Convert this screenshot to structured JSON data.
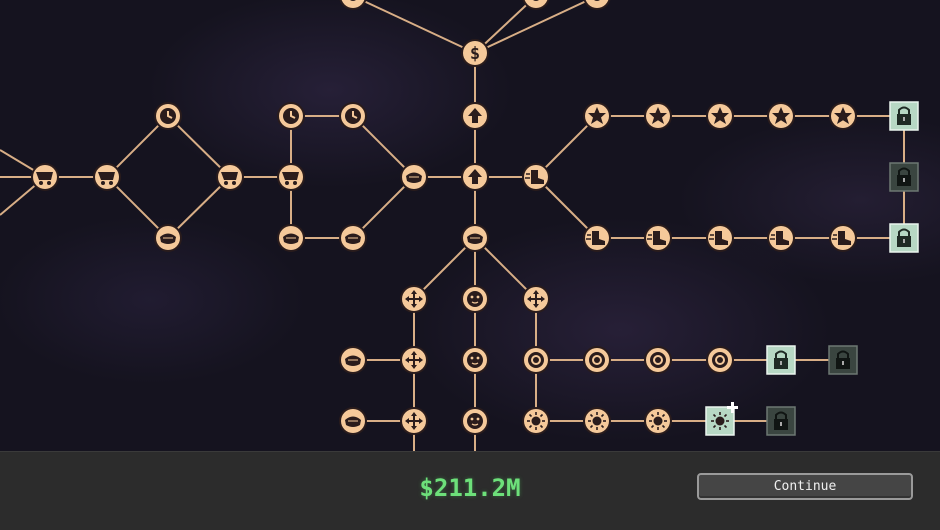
{
  "money_display": "$211.2M",
  "continue_label": "Continue",
  "colors": {
    "node_fill": "#f5c99a",
    "node_ring": "#2a1c1c",
    "line": "#d8ae86",
    "lock_unlocked": "#b7d8c4",
    "lock_locked": "#3a4540",
    "money_text": "#6de07a"
  },
  "nodes": [
    {
      "id": "top-a",
      "icon": "circle-icon"
    },
    {
      "id": "top-b",
      "icon": "circle-icon"
    },
    {
      "id": "top-c",
      "icon": "circle-icon"
    },
    {
      "id": "cash",
      "icon": "dollar-icon"
    },
    {
      "id": "up-1",
      "icon": "arrow-up-icon"
    },
    {
      "id": "center",
      "icon": "arrow-up-icon"
    },
    {
      "id": "bowl-1",
      "icon": "bowl-icon"
    },
    {
      "id": "cart-1",
      "icon": "cart-icon"
    },
    {
      "id": "cart-2",
      "icon": "cart-icon"
    },
    {
      "id": "clock-1",
      "icon": "clock-icon"
    },
    {
      "id": "bowl-2",
      "icon": "bowl-icon"
    },
    {
      "id": "cart-3",
      "icon": "cart-icon"
    },
    {
      "id": "cart-4",
      "icon": "cart-icon"
    },
    {
      "id": "clock-2",
      "icon": "clock-icon"
    },
    {
      "id": "clock-3",
      "icon": "clock-icon"
    },
    {
      "id": "bowl-3",
      "icon": "bowl-icon"
    },
    {
      "id": "bowl-4",
      "icon": "bowl-icon"
    },
    {
      "id": "bowl-5",
      "icon": "bowl-icon"
    },
    {
      "id": "star-1",
      "icon": "star-icon"
    },
    {
      "id": "star-2",
      "icon": "star-icon"
    },
    {
      "id": "star-3",
      "icon": "star-icon"
    },
    {
      "id": "star-4",
      "icon": "star-icon"
    },
    {
      "id": "star-5",
      "icon": "star-icon"
    },
    {
      "id": "boot-1",
      "icon": "boot-icon"
    },
    {
      "id": "boot-2",
      "icon": "boot-icon"
    },
    {
      "id": "boot-3",
      "icon": "boot-icon"
    },
    {
      "id": "boot-4",
      "icon": "boot-icon"
    },
    {
      "id": "boot-5",
      "icon": "boot-icon"
    },
    {
      "id": "boot-6",
      "icon": "boot-icon"
    },
    {
      "id": "face-1",
      "icon": "face-icon"
    },
    {
      "id": "face-2",
      "icon": "face-icon"
    },
    {
      "id": "face-3",
      "icon": "face-icon"
    },
    {
      "id": "face-4",
      "icon": "face-icon"
    },
    {
      "id": "move-1",
      "icon": "move-icon"
    },
    {
      "id": "move-2",
      "icon": "move-icon"
    },
    {
      "id": "move-3",
      "icon": "move-icon"
    },
    {
      "id": "move-4",
      "icon": "move-icon"
    },
    {
      "id": "bowl-6",
      "icon": "bowl-icon"
    },
    {
      "id": "bowl-7",
      "icon": "bowl-icon"
    },
    {
      "id": "target-1",
      "icon": "target-icon"
    },
    {
      "id": "target-2",
      "icon": "target-icon"
    },
    {
      "id": "target-3",
      "icon": "target-icon"
    },
    {
      "id": "target-4",
      "icon": "target-icon"
    },
    {
      "id": "sun-1",
      "icon": "sun-icon"
    },
    {
      "id": "sun-2",
      "icon": "sun-icon"
    },
    {
      "id": "sun-3",
      "icon": "sun-icon"
    }
  ],
  "locks": [
    {
      "id": "lock-star-row",
      "state": "unlocked"
    },
    {
      "id": "lock-mid",
      "state": "locked"
    },
    {
      "id": "lock-boot-row",
      "state": "unlocked"
    },
    {
      "id": "lock-target-row",
      "state": "unlocked"
    },
    {
      "id": "lock-target-row-2",
      "state": "locked"
    },
    {
      "id": "lock-sun-row",
      "state": "locked"
    }
  ],
  "sun_upgrade": {
    "icon": "sun-plus-icon",
    "state": "purchasable"
  }
}
